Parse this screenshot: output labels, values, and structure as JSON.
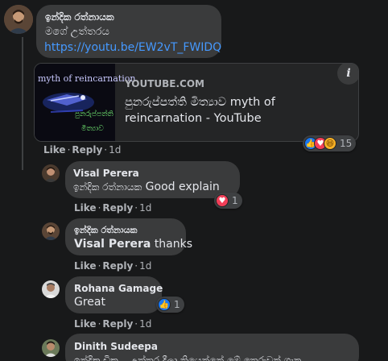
{
  "comments": [
    {
      "author": "ඉන්දික රත්නායක",
      "text": "මගේ උත්තරය",
      "link_text": "https://youtu.be/EW2vT_FWIDQ",
      "preview": {
        "thumb_text_1": "myth of reincarnation",
        "thumb_text_2": "පුනරුප්පත්ති",
        "thumb_text_3": "මිත්‍යාව",
        "source": "YOUTUBE.COM",
        "title_line1": "පුනරුප්පත්ති මිත්‍යාව myth of",
        "title_line2": "reincarnation - YouTube",
        "info_icon": "i"
      },
      "like_label": "Like",
      "reply_label": "Reply",
      "time": "1d",
      "reactions": {
        "icons": [
          "like-icon",
          "love-icon",
          "haha-icon"
        ],
        "count": "15"
      }
    }
  ],
  "replies": [
    {
      "author": "Visal Perera",
      "mention": "ඉන්දික රත්නායක",
      "text": "Good explain",
      "like_label": "Like",
      "reply_label": "Reply",
      "time": "1d",
      "reactions": {
        "icons": [
          "love-icon"
        ],
        "count": "1"
      }
    },
    {
      "author": "ඉන්දික රත්නායක",
      "mention": "Visal Perera",
      "text": "thanks",
      "like_label": "Like",
      "reply_label": "Reply",
      "time": "1d"
    },
    {
      "author": "Rohana Gamage",
      "text": "Great",
      "like_label": "Like",
      "reply_label": "Reply",
      "time": "1d",
      "reactions": {
        "icons": [
          "like-icon"
        ],
        "count": "1"
      }
    },
    {
      "author": "Dinith Sudeepa",
      "text": "ඉන්දික ඩිකු... උත්තර දීලා තියෙන්නේ මේ තෙරුවන් ගැන"
    }
  ],
  "colors": {
    "background": "#18191a",
    "bubble": "#3a3b3c",
    "link": "#4599ff",
    "like": "#1877f2",
    "love": "#f33e58",
    "haha": "#f7b125"
  }
}
